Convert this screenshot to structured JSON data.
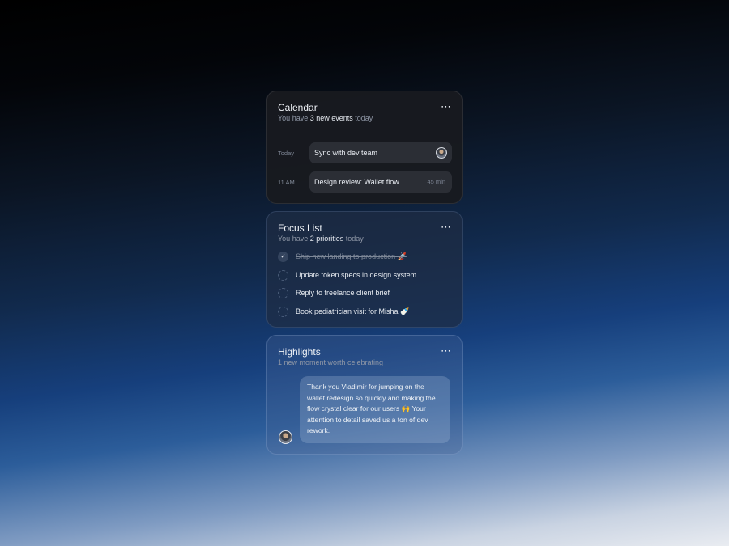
{
  "calendar": {
    "title": "Calendar",
    "subtitle_prefix": "You have ",
    "subtitle_bold": "3 new events",
    "subtitle_suffix": " today",
    "more_icon": "⋯",
    "events": [
      {
        "time": "Today",
        "title": "Sync with dev team",
        "duration": "",
        "accent": "#e8b04a"
      },
      {
        "time": "11 AM",
        "title": "Design review: Wallet flow",
        "duration": "45 min",
        "accent": "#c9ced6"
      }
    ]
  },
  "focus": {
    "title": "Focus List",
    "subtitle_prefix": "You have ",
    "subtitle_bold": "2 priorities",
    "subtitle_suffix": " today",
    "more_icon": "⋯",
    "tasks": [
      {
        "label": "Ship new landing to production 🚀",
        "done": true,
        "check_icon": "✓"
      },
      {
        "label": "Update token specs in design system",
        "done": false
      },
      {
        "label": "Reply to freelance client brief",
        "done": false
      },
      {
        "label": "Book pediatrician visit for Misha 🍼",
        "done": false
      }
    ]
  },
  "highlights": {
    "title": "Highlights",
    "subtitle": "1 new moment worth celebrating",
    "more_icon": "⋯",
    "message": "Thank you Vladimir for jumping on the wallet redesign so quickly and making the flow crystal clear for our users 🙌 Your attention to detail saved us a ton of dev rework."
  }
}
